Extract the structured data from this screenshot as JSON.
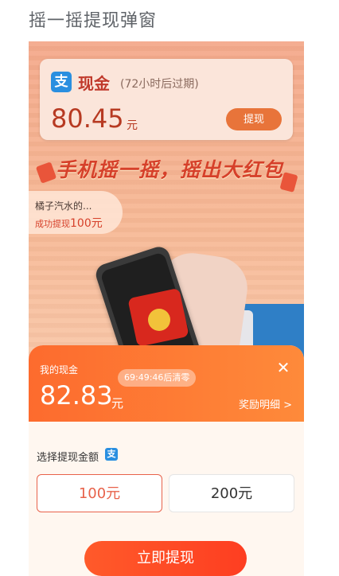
{
  "page": {
    "title": "摇一摇提现弹窗"
  },
  "cash_card": {
    "logo_char": "支",
    "title": "现金",
    "expire_note": "(72小时后过期)",
    "amount": "80.45",
    "unit": "元",
    "withdraw_label": "提现"
  },
  "banner": {
    "slogan": "手机摇一摇，摇出大红包"
  },
  "ticker": {
    "name": "橘子汽水的...",
    "text": "成功提现",
    "amount": "100元"
  },
  "sheet": {
    "my_cash_label": "我的现金",
    "countdown": "69:49:46后清零",
    "amount": "82.83",
    "unit": "元",
    "reward_detail": "奖励明细 >",
    "close_icon": "close-icon",
    "choose_label": "选择提现金额",
    "choose_icon_char": "支",
    "options": [
      {
        "label": "100元",
        "selected": true
      },
      {
        "label": "200元",
        "selected": false
      }
    ],
    "withdraw_button": "立即提现"
  },
  "colors": {
    "accent": "#fe5a2a",
    "alipay_blue": "#2a8fe0",
    "selected_border": "#e8624a"
  }
}
